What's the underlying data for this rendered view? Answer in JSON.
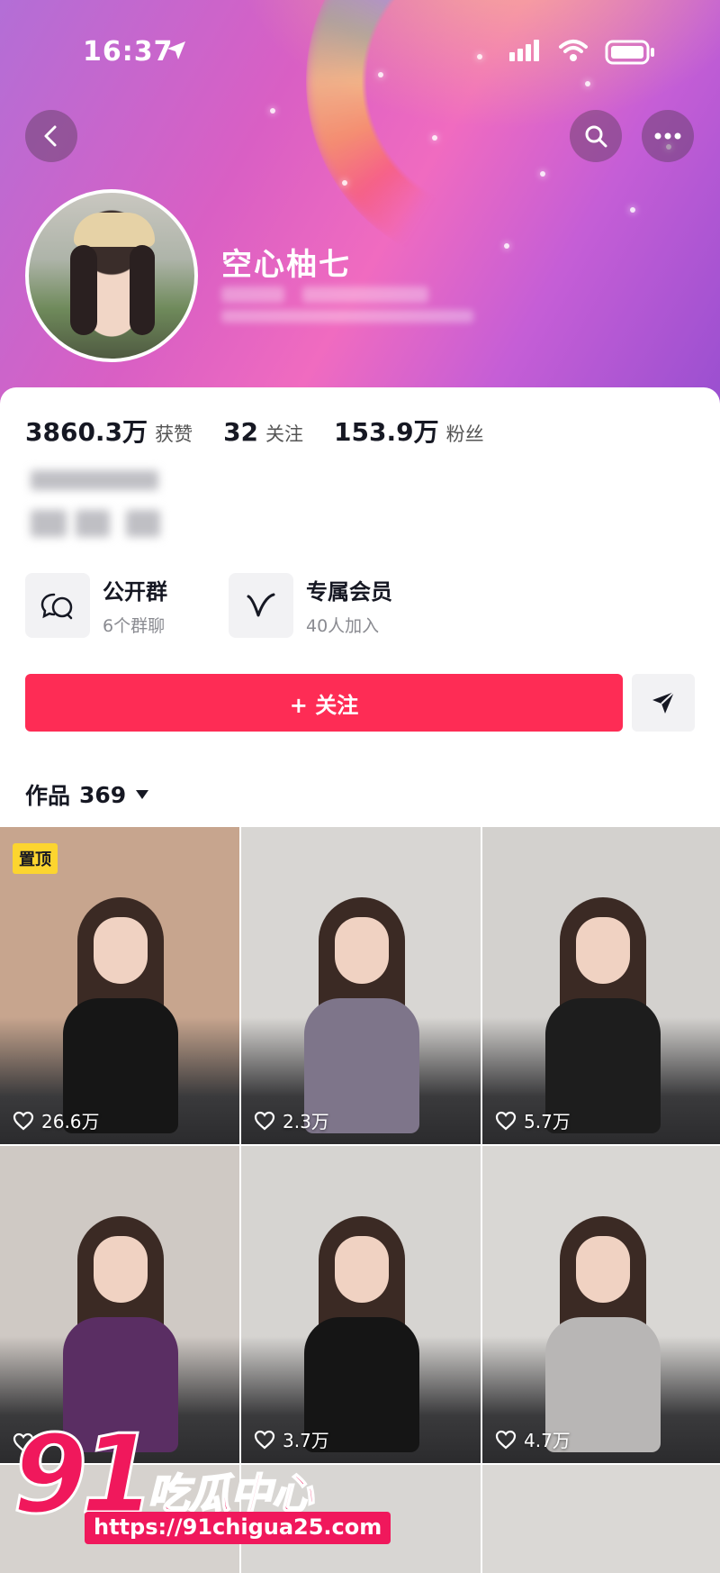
{
  "status_bar": {
    "time": "16:37"
  },
  "profile": {
    "username": "空心柚七"
  },
  "stats": [
    {
      "value": "3860.3万",
      "label": "获赞"
    },
    {
      "value": "32",
      "label": "关注"
    },
    {
      "value": "153.9万",
      "label": "粉丝"
    }
  ],
  "features": [
    {
      "title": "公开群",
      "subtitle": "6个群聊",
      "icon": "chat-group-icon"
    },
    {
      "title": "专属会员",
      "subtitle": "40人加入",
      "icon": "vip-v-icon"
    }
  ],
  "actions": {
    "follow_label": "+ 关注"
  },
  "works": {
    "label": "作品",
    "count": "369"
  },
  "videos": [
    {
      "likes": "26.6万",
      "pinned_label": "置顶",
      "top": "#c7a58e",
      "outfit": "#161616"
    },
    {
      "likes": "2.3万",
      "top": "#d8d6d3",
      "outfit": "#7e758a"
    },
    {
      "likes": "5.7万",
      "top": "#d3d1ce",
      "outfit": "#1d1d1d"
    },
    {
      "likes": "",
      "top": "#cfc9c4",
      "outfit": "#5a2e63"
    },
    {
      "likes": "3.7万",
      "top": "#d6d4d1",
      "outfit": "#151515"
    },
    {
      "likes": "4.7万",
      "top": "#d9d7d4",
      "outfit": "#b8b6b5"
    }
  ],
  "watermark": {
    "number": "91",
    "name": "吃瓜中心",
    "url": "https://91chigua25.com"
  },
  "colors": {
    "primary": "#fe2c55",
    "pin": "#fcd52f"
  }
}
